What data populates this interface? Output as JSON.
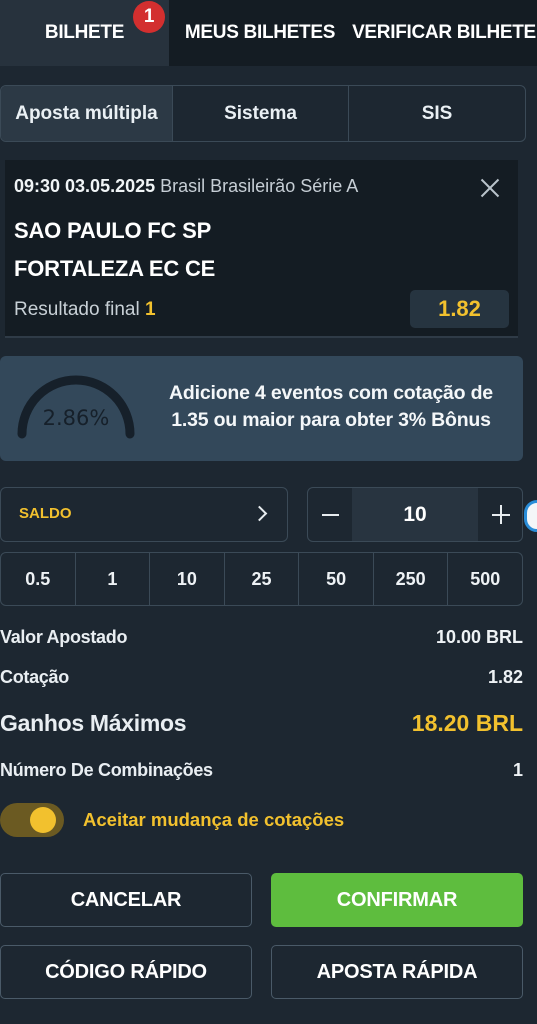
{
  "tabs": [
    {
      "label": "BILHETE",
      "badge": "1"
    },
    {
      "label": "MEUS BILHETES"
    },
    {
      "label": "VERIFICAR BILHETE"
    }
  ],
  "bet_types": [
    "Aposta múltipla",
    "Sistema",
    "SIS"
  ],
  "event": {
    "datetime": "09:30 03.05.2025",
    "league": "Brasil Brasileirão Série A",
    "home": "SAO PAULO FC SP",
    "away": "FORTALEZA EC CE",
    "market": "Resultado final",
    "selection": "1",
    "odds": "1.82"
  },
  "bonus": {
    "gauge_value": "2.86%",
    "gauge_fraction": 0.5,
    "line1": "Adicione 4 eventos com cotação de",
    "line2": "1.35 ou maior para obter 3% Bônus"
  },
  "stake": {
    "saldo_label": "SALDO",
    "amount": "10"
  },
  "quick_stakes": [
    "0.5",
    "1",
    "10",
    "25",
    "50",
    "250",
    "500"
  ],
  "summary": {
    "stake_label": "Valor Apostado",
    "stake_value": "10.00 BRL",
    "odds_label": "Cotação",
    "odds_value": "1.82",
    "max_win_label": "Ganhos Máximos",
    "max_win_value": "18.20 BRL",
    "combos_label": "Número De Combinações",
    "combos_value": "1"
  },
  "accept_changes": {
    "label": "Aceitar mudança de cotações",
    "on": true
  },
  "buttons": {
    "cancel": "CANCELAR",
    "confirm": "CONFIRMAR",
    "quick_code": "CÓDIGO RÁPIDO",
    "quick_bet": "APOSTA RÁPIDA"
  },
  "colors": {
    "accent": "#f2c12e",
    "confirm": "#5ebd3e",
    "badge": "#d32f2f",
    "background": "#1d2731"
  }
}
